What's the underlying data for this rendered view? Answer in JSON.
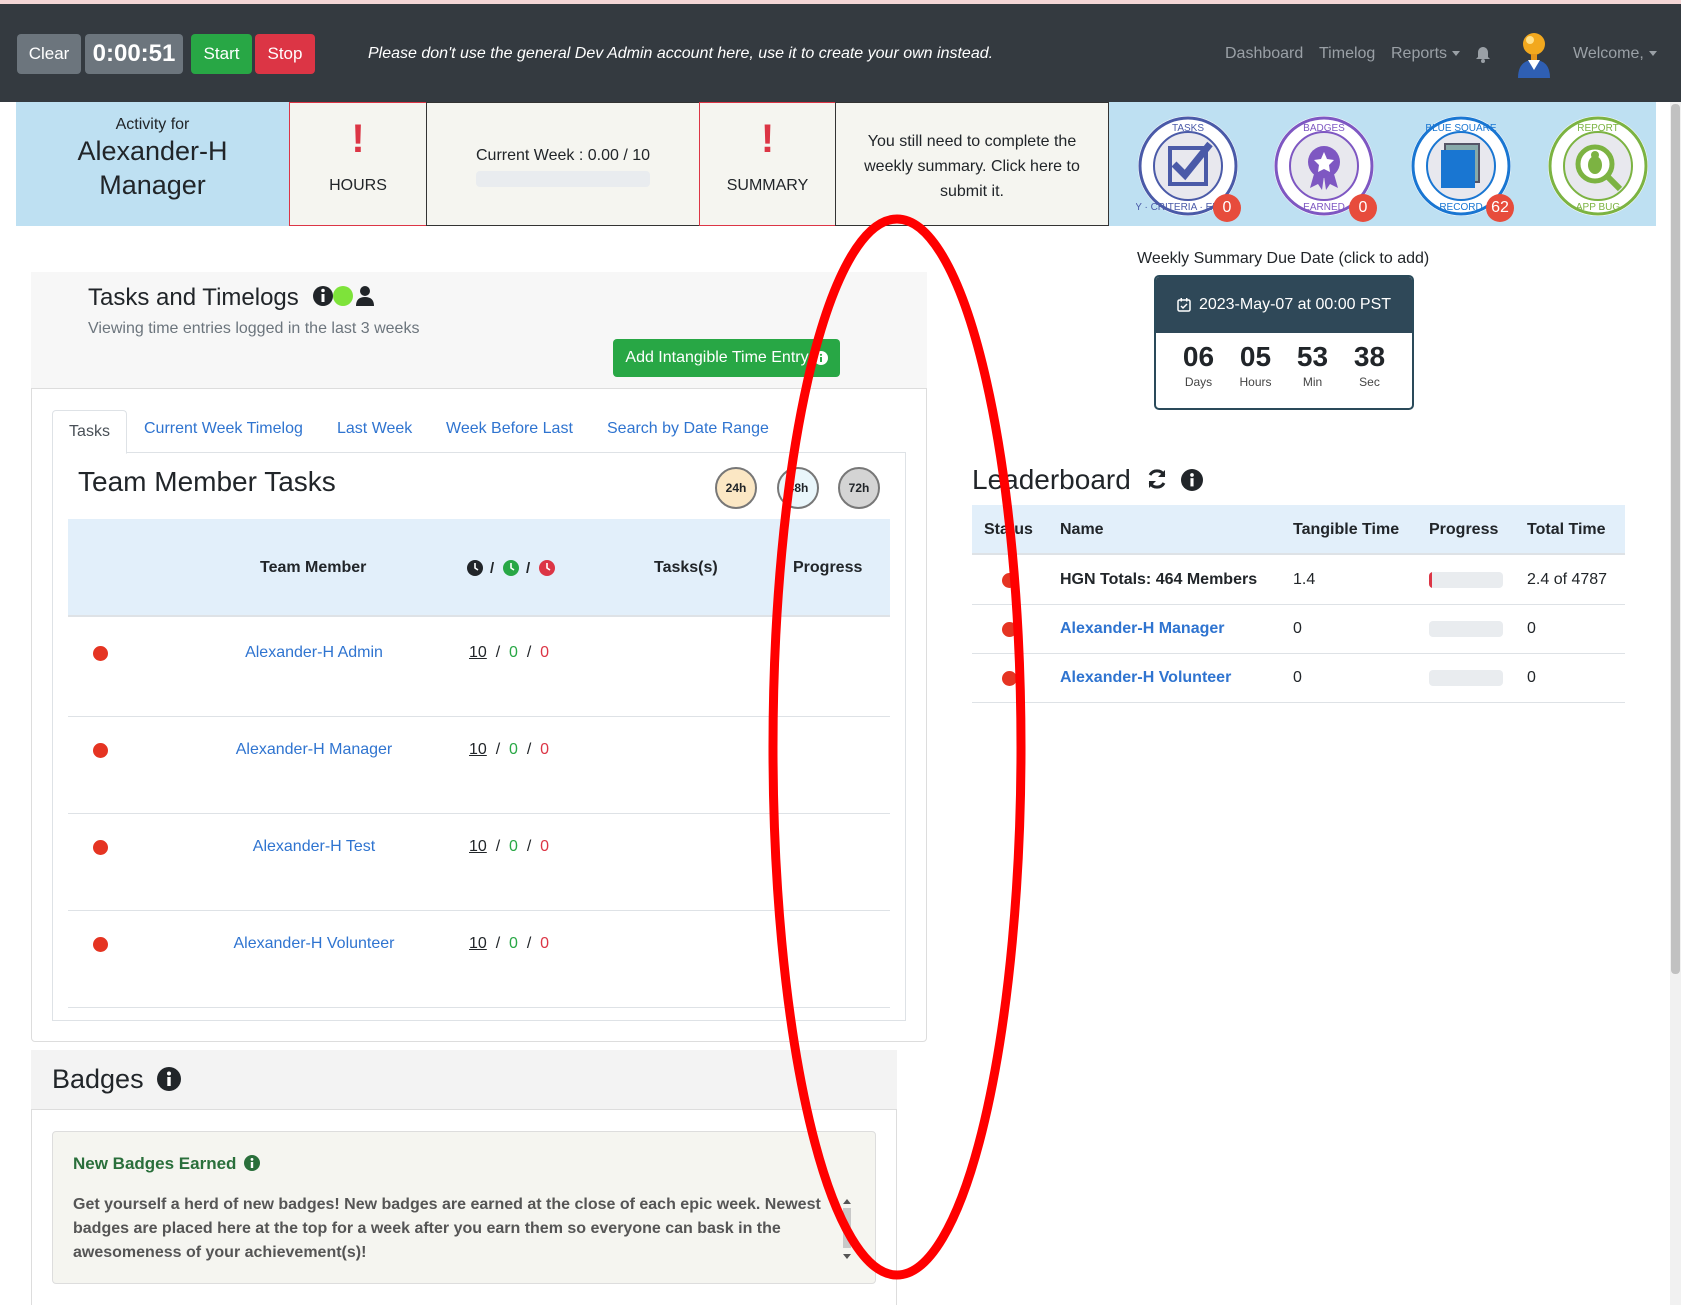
{
  "navbar": {
    "clear_label": "Clear",
    "timer": "0:00:51",
    "start_label": "Start",
    "stop_label": "Stop",
    "message": "Please don't use the general Dev Admin account here, use it to create your own instead.",
    "links": {
      "dashboard": "Dashboard",
      "timelog": "Timelog",
      "reports": "Reports",
      "welcome": "Welcome,"
    }
  },
  "activity": {
    "label": "Activity for",
    "name_line1": "Alexander-H",
    "name_line2": "Manager",
    "hours_mark": "!",
    "hours_label": "HOURS",
    "current_week": "Current Week : 0.00 / 10",
    "current_week_progress": 0,
    "summary_mark": "!",
    "summary_label": "SUMMARY",
    "summary_message": "You still need to complete the weekly summary. Click here to submit it.",
    "badges": [
      {
        "icon": "tasks-badge-icon",
        "top": "TASKS",
        "bottom": "WHY · CRITERIA · ENDSTATE",
        "count": "0",
        "color": "#4a5aa8"
      },
      {
        "icon": "badges-earned-icon",
        "top": "BADGES",
        "bottom": "EARNED",
        "count": "0",
        "color": "#7e57c2"
      },
      {
        "icon": "blue-square-record-icon",
        "top": "BLUE SQUARE",
        "bottom": "RECORD",
        "count": "62",
        "color": "#1976d2"
      },
      {
        "icon": "report-app-bug-icon",
        "top": "REPORT",
        "bottom": "APP BUG",
        "count": "",
        "color": "#7cb342"
      }
    ]
  },
  "tasks": {
    "title": "Tasks and Timelogs",
    "subtitle": "Viewing time entries logged in the last 3 weeks",
    "add_button": "Add Intangible Time Entry",
    "tabs": [
      "Tasks",
      "Current Week Timelog",
      "Last Week",
      "Week Before Last",
      "Search by Date Range"
    ],
    "team_title": "Team Member Tasks",
    "hour_filters": [
      "24h",
      "48h",
      "72h"
    ],
    "columns": {
      "member": "Team Member",
      "hours_sep": "/",
      "tasks": "Tasks(s)",
      "progress": "Progress"
    },
    "rows": [
      {
        "name": "Alexander-H Admin",
        "committed": "10",
        "logged": "0",
        "remaining": "0"
      },
      {
        "name": "Alexander-H Manager",
        "committed": "10",
        "logged": "0",
        "remaining": "0"
      },
      {
        "name": "Alexander-H Test",
        "committed": "10",
        "logged": "0",
        "remaining": "0"
      },
      {
        "name": "Alexander-H Volunteer",
        "committed": "10",
        "logged": "0",
        "remaining": "0"
      }
    ]
  },
  "badges_section": {
    "title": "Badges",
    "new_title": "New Badges Earned",
    "new_text": "Get yourself a herd of new badges! New badges are earned at the close of each epic week. Newest badges are placed here at the top for a week after you earn them so everyone can bask in the awesomeness of your achievement(s)!"
  },
  "due": {
    "label": "Weekly Summary Due Date (click to add)",
    "date": "2023-May-07 at 00:00 PST",
    "days": "06",
    "days_label": "Days",
    "hours": "05",
    "hours_label": "Hours",
    "min": "53",
    "min_label": "Min",
    "sec": "38",
    "sec_label": "Sec"
  },
  "leaderboard": {
    "title": "Leaderboard",
    "columns": {
      "status": "Status",
      "name": "Name",
      "tangible": "Tangible Time",
      "progress": "Progress",
      "total": "Total Time"
    },
    "rows": [
      {
        "name": "HGN Totals: 464 Members",
        "tangible": "1.4",
        "progress": 0.04,
        "total": "2.4 of 4787",
        "is_total": true
      },
      {
        "name": "Alexander-H Manager",
        "tangible": "0",
        "progress": 0,
        "total": "0",
        "is_total": false
      },
      {
        "name": "Alexander-H Volunteer",
        "tangible": "0",
        "progress": 0,
        "total": "0",
        "is_total": false
      }
    ]
  },
  "colors": {
    "navbar": "#343a40",
    "activity": "#bee0f2",
    "link": "#2f74d0",
    "danger": "#dc3545",
    "success": "#28a745",
    "annotation": "#ff0000"
  }
}
